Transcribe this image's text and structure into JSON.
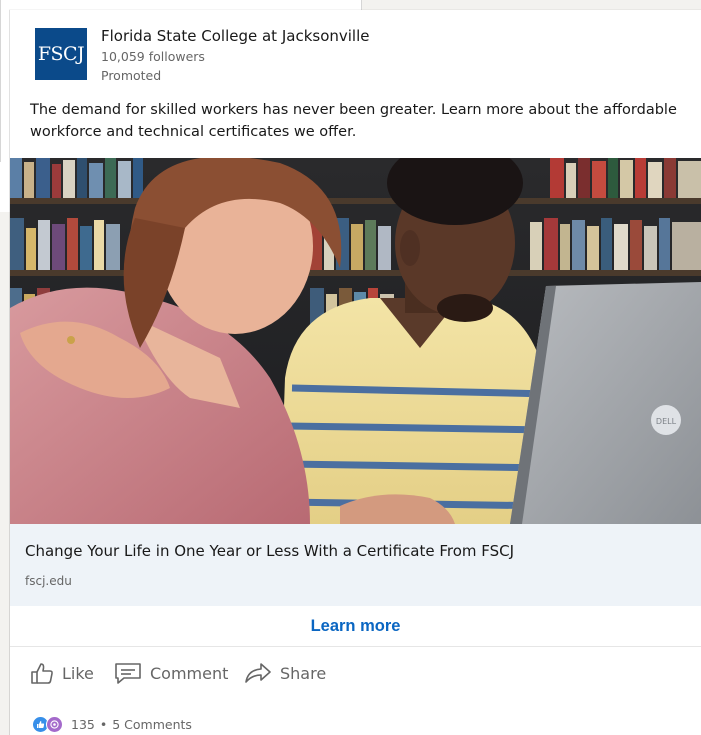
{
  "org": {
    "name": "Florida State College at Jacksonville",
    "followers": "10,059 followers",
    "promoted": "Promoted",
    "logo_text": "FSCJ",
    "logo_color": "#0b4a8a"
  },
  "post": {
    "text": "The demand for skilled workers has never been greater. Learn more about the affordable workforce and technical certificates we offer."
  },
  "link_card": {
    "title": "Change Your Life in One Year or Less With a Certificate From FSCJ",
    "domain": "fscj.edu",
    "laptop_logo": "DELL"
  },
  "cta": {
    "label": "Learn more",
    "color": "#0a66c2"
  },
  "actions": [
    {
      "label": "Like",
      "icon": "thumbs-up-icon"
    },
    {
      "label": "Comment",
      "icon": "comment-icon"
    },
    {
      "label": "Share",
      "icon": "share-icon"
    }
  ],
  "social": {
    "reactions": [
      "like-reaction-icon",
      "love-reaction-icon"
    ],
    "count": "135",
    "separator": "•",
    "comments": "5 Comments"
  }
}
